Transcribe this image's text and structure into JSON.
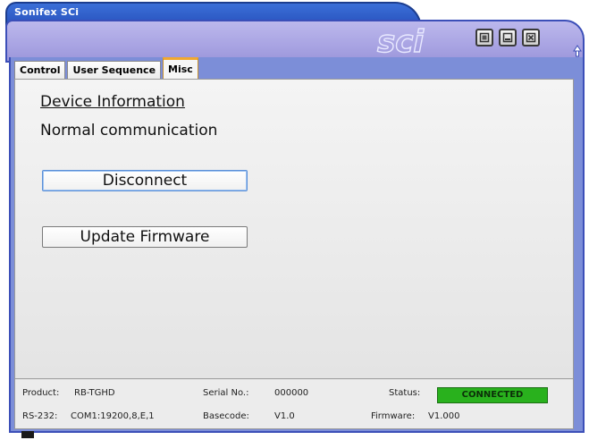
{
  "window": {
    "title": "Sonifex SCi"
  },
  "header": {
    "logo_text": "sci",
    "buttons": [
      {
        "icon": "restore-icon"
      },
      {
        "icon": "minimize-icon"
      },
      {
        "icon": "close-icon"
      }
    ]
  },
  "tabs": [
    {
      "label": "Control",
      "active": false
    },
    {
      "label": "User Sequence",
      "active": false
    },
    {
      "label": "Misc",
      "active": true
    }
  ],
  "content": {
    "section_title": "Device Information",
    "comm_status": "Normal communication",
    "disconnect_label": "Disconnect",
    "update_firmware_label": "Update Firmware"
  },
  "statusbar": {
    "product_label": "Product:",
    "product_value": "RB-TGHD",
    "serial_label": "Serial No.:",
    "serial_value": "000000",
    "status_label": "Status:",
    "status_value": "CONNECTED",
    "rs232_label": "RS-232:",
    "rs232_value": "COM1:19200,8,E,1",
    "basecode_label": "Basecode:",
    "basecode_value": "V1.0",
    "firmware_label": "Firmware:",
    "firmware_value": "V1.000"
  },
  "colors": {
    "title_blue": "#2a55c0",
    "header_lavender": "#aaa5e3",
    "status_green": "#29b11d",
    "active_tab_accent": "#f0a830"
  }
}
